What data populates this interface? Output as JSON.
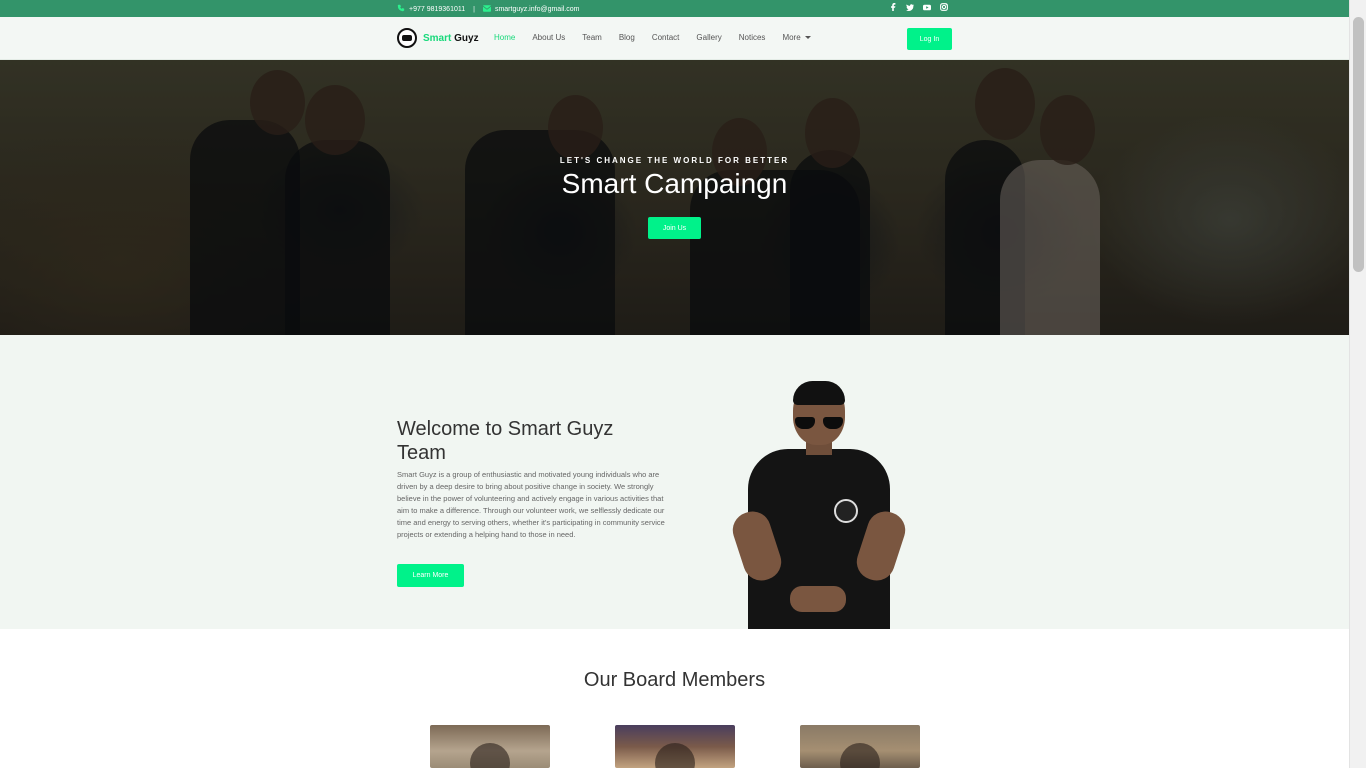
{
  "topbar": {
    "phone": "+977 9819361011",
    "separator": "|",
    "email": "smartguyz.info@gmail.com",
    "social_icons": [
      "facebook-icon",
      "twitter-icon",
      "youtube-icon",
      "instagram-icon"
    ]
  },
  "brand": {
    "name_accent": "Smart",
    "name_rest": " Guyz"
  },
  "nav": {
    "items": [
      "Home",
      "About Us",
      "Team",
      "Blog",
      "Contact",
      "Gallery",
      "Notices",
      "More"
    ],
    "active": "Home",
    "login_label": "Log In"
  },
  "hero": {
    "kicker": "LET'S CHANGE THE WORLD FOR BETTER",
    "title": "Smart Campaingn",
    "button_label": "Join Us"
  },
  "welcome": {
    "title": "Welcome to Smart Guyz Team",
    "body": "Smart Guyz is a group of enthusiastic and motivated young individuals who are driven by a deep desire to bring about positive change in society. We strongly believe in the power of volunteering and actively engage in various activities that aim to make a difference. Through our volunteer work, we selflessly dedicate our time and energy to serving others, whether it's participating in community service projects or extending a helping hand to those in need.",
    "button_label": "Learn More"
  },
  "board": {
    "title": "Our Board Members"
  },
  "colors": {
    "accent": "#00f28a",
    "topbar": "#33946a",
    "brand_accent": "#18d97b"
  }
}
